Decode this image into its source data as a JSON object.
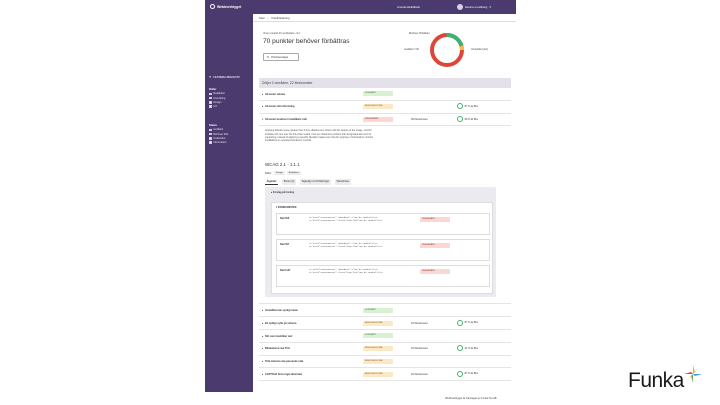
{
  "header": {
    "logo": "Webbverktyget",
    "nav": "Ansvarsskildlistar",
    "user": "Hanna Lundberg"
  },
  "breadcrumb": [
    "Start",
    "Kravförteckning"
  ],
  "summary": {
    "small_label": "Visar resultat för webbplats: cinc",
    "title": "70 punkter behöver förbättras",
    "prioritize_button": "Prioritera lägre",
    "donut_labels": {
      "top": "Behöver förbättras",
      "left": "Godkänt / OK",
      "right": "Underkänt (42)"
    },
    "donut_colors": {
      "good": "#3cb371",
      "warn": "#f0c040",
      "bad": "#e0453a"
    }
  },
  "sidebar": {
    "filter_toggle": "FILTRERA RESULTAT",
    "groups": [
      {
        "title": "Roller",
        "options": [
          "Redaktion",
          "Utveckling",
          "Design",
          "UX"
        ]
      },
      {
        "title": "Status",
        "options": [
          "Godkänt",
          "Behöver förb.",
          "Underkänt",
          "Information"
        ]
      }
    ]
  },
  "list": {
    "header": "Döljer 0 områden, 22 förekomster",
    "rows_before": [
      {
        "chev": "▸",
        "name": "Alt-texter saknas",
        "status": "GODKÄNT",
        "status_kind": "ok",
        "count": "",
        "pct": ""
      },
      {
        "chev": "▸",
        "name": "Alt-texter rätt utformning",
        "status": "BEHÖVER FÖRB.",
        "status_kind": "warn",
        "count": "",
        "pct": "87 % är Bra"
      },
      {
        "chev": "▾",
        "name": "Alt-texter beskriver innehållets mål",
        "status": "UNDERKÄNT",
        "status_kind": "bad",
        "count": "39 förekomster",
        "pct": "69 % är Bra"
      }
    ],
    "expanded": {
      "description": "Applying title/alt-mouse greater than 0 Any effektiva text shown with the feature of the image. Control. Indicates the text user the link when tested, how are characters problem that designated alert text for supporting, instead of applying a specific title/alter makes sure that the purpose of information controls installations in extended interaction controls.",
      "wcag": "WCAG 2.1 - 1.1.1",
      "roles_label": "Roller:",
      "roles": [
        "Design",
        "Redaktion"
      ],
      "tabs": [
        "Åtgärder",
        "Brister (3)",
        "Tagkeltig mot förbättringar",
        "Tjänstbrister"
      ],
      "examples_head": "Förslag på lösning",
      "violations_head": "FÖREKOMSTER",
      "violations": [
        {
          "label": "Rad 306",
          "code": "<a href=\"#MainContent\" tabindex=\"-1\">Gå du innehåll</a>\n<a href=\"#MainContent\" class=\"skip-link\">Gå du innehåll</a>",
          "status": "UNDERKÄNT"
        },
        {
          "label": "Rad 467",
          "code": "<a href=\"#MainContent\" tabindex=\"-1\">Gå du innehåll</a>\n<a href=\"#MainContent\" class=\"skip-link\">Gå du innehåll</a>",
          "status": "UNDERKÄNT"
        },
        {
          "label": "Rad 1127",
          "code": "<a href=\"#MainContent\" tabindex=\"-1\">Gå du innehåll</a>\n<a href=\"#MainContent\" class=\"skip-link\">Gå du innehåll</a>",
          "status": "UNDERKÄNT"
        }
      ]
    },
    "rows_after": [
      {
        "chev": "▸",
        "name": "Innehållet inte synligt innan",
        "status": "GODKÄNT",
        "status_kind": "ok",
        "count": "",
        "pct": ""
      },
      {
        "chev": "▸",
        "name": "Ett tydligt syfte på sidorna",
        "status": "BEHÖVER FÖRB.",
        "status_kind": "warn",
        "count": "16 förekomster",
        "pct": "87 % är Bra"
      },
      {
        "chev": "▸",
        "name": "Stil som innehåller text",
        "status": "GODKÄNT",
        "status_kind": "ok",
        "count": "",
        "pct": ""
      },
      {
        "chev": "▸",
        "name": "Bildtexterna ska Tills",
        "status": "BEHÖVER FÖRB.",
        "status_kind": "warn",
        "count": "16 förekomster",
        "pct": "41 % är Bra"
      },
      {
        "chev": "▸",
        "name": "Titla texterna ska passande sida",
        "status": "BEHÖVER FÖRB.",
        "status_kind": "warn",
        "count": "",
        "pct": ""
      },
      {
        "chev": "▸",
        "name": "CAPTCHA finns inget alternativ",
        "status": "BEHÖVER FÖRB.",
        "status_kind": "warn",
        "count": "16 förekomster",
        "pct": "87 % är Bra"
      }
    ]
  },
  "footer": {
    "text": "Webbverktyget är framtaget av Funka Nu AB"
  },
  "brand": {
    "name": "Funka",
    "colors": [
      "#f0b020",
      "#3aa0d8",
      "#6ab04c",
      "#e0453a"
    ]
  }
}
